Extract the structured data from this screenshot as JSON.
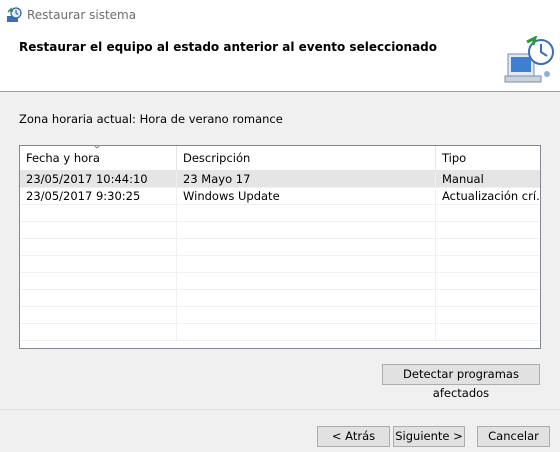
{
  "window": {
    "title": "Restaurar sistema"
  },
  "header": {
    "title": "Restaurar el equipo al estado anterior al evento seleccionado"
  },
  "timezone_label": "Zona horaria actual: Hora de verano romance",
  "table": {
    "columns": [
      "Fecha y hora",
      "Descripción",
      "Tipo"
    ],
    "rows": [
      {
        "date": "23/05/2017 10:44:10",
        "description": "23 Mayo 17",
        "type": "Manual",
        "selected": true
      },
      {
        "date": "23/05/2017 9:30:25",
        "description": "Windows Update",
        "type": "Actualización crí…",
        "selected": false
      }
    ]
  },
  "buttons": {
    "detect": "Detectar programas afectados",
    "back": "< Atrás",
    "next": "Siguiente >",
    "cancel": "Cancelar"
  },
  "icons": {
    "app": "system-restore-icon",
    "header": "computer-restore-icon",
    "sort": "sort-down-icon"
  },
  "colors": {
    "selected_row": "#e5e5e5",
    "button_face": "#e1e1e1"
  }
}
